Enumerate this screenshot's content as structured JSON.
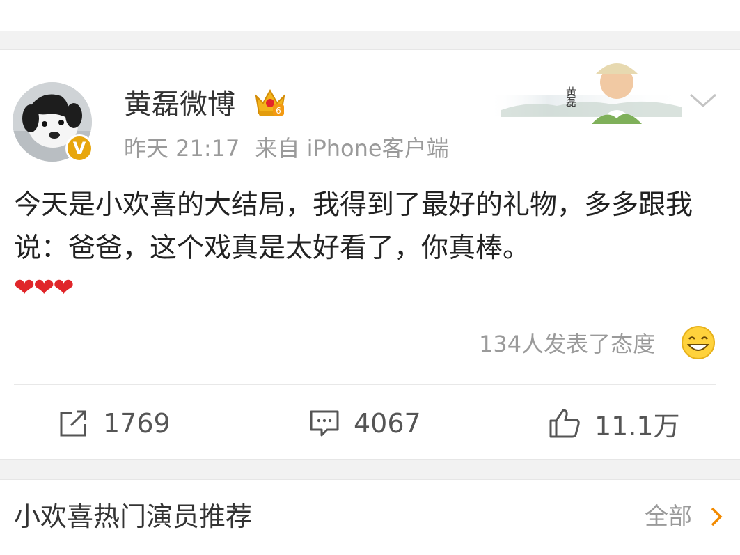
{
  "post": {
    "author": "黄磊微博",
    "time": "昨天 21:17",
    "source": "来自 iPhone客户端",
    "banner_text": "黄磊",
    "text": "今天是小欢喜的大结局，我得到了最好的礼物，多多跟我说：爸爸，这个戏真是太好看了，你真棒。",
    "emoji_hearts": "❤❤❤",
    "attitude_text": "134人发表了态度",
    "crown_level": "6",
    "verified_badge": "V"
  },
  "actions": {
    "repost_count": "1769",
    "comment_count": "4067",
    "like_count": "11.1万"
  },
  "recommend": {
    "title": "小欢喜热门演员推荐",
    "all_label": "全部"
  },
  "colors": {
    "accent_orange": "#f28a00",
    "badge_gold": "#e8a60c",
    "heart_red": "#e0262a"
  },
  "icons": [
    "crown-icon",
    "chevron-down-icon",
    "smile-icon",
    "repost-icon",
    "comment-icon",
    "like-icon",
    "chevron-right-icon"
  ]
}
